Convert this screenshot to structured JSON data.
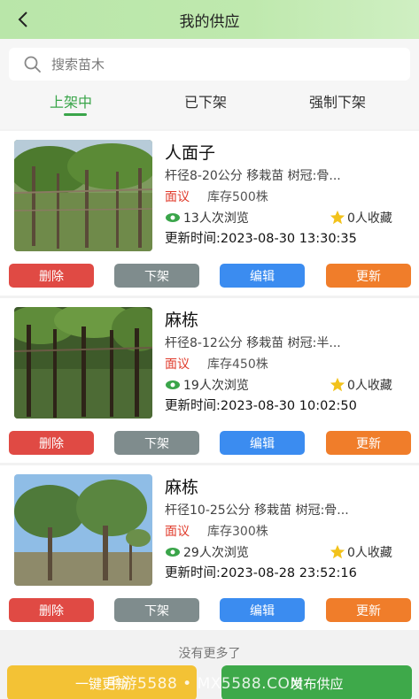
{
  "header": {
    "title": "我的供应"
  },
  "search": {
    "placeholder": "搜索苗木"
  },
  "tabs": [
    {
      "label": "上架中",
      "active": true
    },
    {
      "label": "已下架",
      "active": false
    },
    {
      "label": "强制下架",
      "active": false
    }
  ],
  "items": [
    {
      "name": "人面子",
      "spec": "杆径8-20公分 移栽苗 树冠:骨...",
      "price": "面议",
      "stock": "库存500株",
      "views": "13人次浏览",
      "favorites": "0人收藏",
      "updated": "更新时间:2023-08-30 13:30:35",
      "actions": {
        "delete": "删除",
        "unlist": "下架",
        "edit": "编辑",
        "update": "更新"
      }
    },
    {
      "name": "麻栋",
      "spec": "杆径8-12公分 移栽苗 树冠:半...",
      "price": "面议",
      "stock": "库存450株",
      "views": "19人次浏览",
      "favorites": "0人收藏",
      "updated": "更新时间:2023-08-30 10:02:50",
      "actions": {
        "delete": "删除",
        "unlist": "下架",
        "edit": "编辑",
        "update": "更新"
      }
    },
    {
      "name": "麻栋",
      "spec": "杆径10-25公分 移栽苗 树冠:骨...",
      "price": "面议",
      "stock": "库存300株",
      "views": "29人次浏览",
      "favorites": "0人收藏",
      "updated": "更新时间:2023-08-28 23:52:16",
      "actions": {
        "delete": "删除",
        "unlist": "下架",
        "edit": "编辑",
        "update": "更新"
      }
    }
  ],
  "footer_note": "没有更多了",
  "bottom_bar": {
    "refresh_all": "一键更新",
    "publish": "发布供应"
  },
  "watermark": "手游5588 • MX5588.COM",
  "colors": {
    "accent_green": "#3aa54a",
    "price_red": "#e03a2a",
    "delete": "#e04a44",
    "unlist": "#7f8c8d",
    "edit": "#3b8cf0",
    "update": "#f07d2a",
    "refresh_all": "#f3c235",
    "publish": "#3ea94a"
  }
}
